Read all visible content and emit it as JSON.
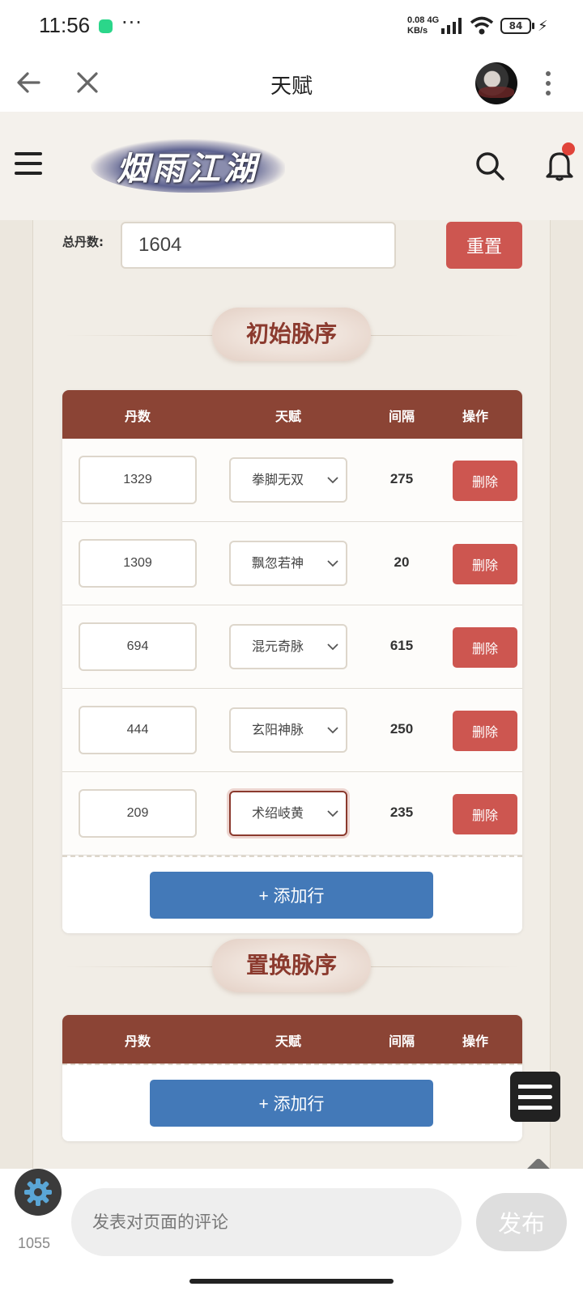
{
  "status_bar": {
    "time": "11:56",
    "dots": "···",
    "net_speed_value": "0.08",
    "net_speed_unit": "KB/s",
    "network": "4G",
    "battery": "84"
  },
  "nav": {
    "title": "天赋"
  },
  "site": {
    "logo_text": "烟雨江湖"
  },
  "form": {
    "total_label": "总丹数:",
    "total_value": "1604",
    "reset_label": "重置"
  },
  "sections": [
    {
      "title": "初始脉序",
      "columns": [
        "丹数",
        "天赋",
        "间隔",
        "操作"
      ],
      "rows": [
        {
          "dan": "1329",
          "talent": "拳脚无双",
          "gap": "275",
          "action": "删除"
        },
        {
          "dan": "1309",
          "talent": "飘忽若神",
          "gap": "20",
          "action": "删除"
        },
        {
          "dan": "694",
          "talent": "混元奇脉",
          "gap": "615",
          "action": "删除"
        },
        {
          "dan": "444",
          "talent": "玄阳神脉",
          "gap": "250",
          "action": "删除"
        },
        {
          "dan": "209",
          "talent": "术绍岐黄",
          "gap": "235",
          "action": "删除"
        }
      ],
      "add_label": "+ 添加行"
    },
    {
      "title": "置换脉序",
      "columns": [
        "丹数",
        "天赋",
        "间隔",
        "操作"
      ],
      "rows": [],
      "add_label": "+ 添加行"
    }
  ],
  "comment": {
    "like_count": "1055",
    "placeholder": "发表对页面的评论",
    "publish_label": "发布"
  },
  "colors": {
    "header_brown": "#8b4435",
    "danger_red": "#cd5650",
    "primary_blue": "#4379b8",
    "section_title": "#8b3a2e"
  },
  "icons": [
    "back-icon",
    "close-icon",
    "avatar",
    "more-icon",
    "menu-icon",
    "search-icon",
    "bell-icon",
    "chevron-down-icon",
    "list-icon",
    "scroll-top-icon",
    "gear-icon"
  ]
}
